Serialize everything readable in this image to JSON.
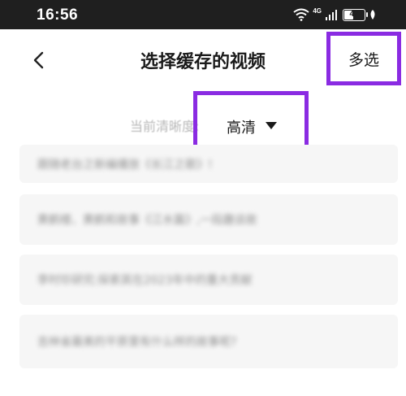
{
  "status_bar": {
    "time": "16:56",
    "network_label": "4G",
    "battery_level": "47",
    "battery_fraction": 0.47
  },
  "nav": {
    "title": "选择缓存的视频",
    "multi_select_label": "多选",
    "back_icon": "chevron-left-icon"
  },
  "quality": {
    "label": "当前清晰度:",
    "value": "高清",
    "caret_icon": "caret-down-icon"
  },
  "videos": [
    {
      "title": "跟随老台之新编播放《长江之歌》!"
    },
    {
      "title": "黄鹤楼、黄鹤和故事《江水篇》,一段趣谈故"
    },
    {
      "title": "李时珍研究:探索其在2023年中的重大贡献"
    },
    {
      "title": "吉林省最美的平原里有什么样的故事呢?"
    }
  ],
  "colors": {
    "highlight": "#8a2be2",
    "status_bar_bg": "#1f1f1f",
    "list_item_bg": "#f6f6f6"
  }
}
